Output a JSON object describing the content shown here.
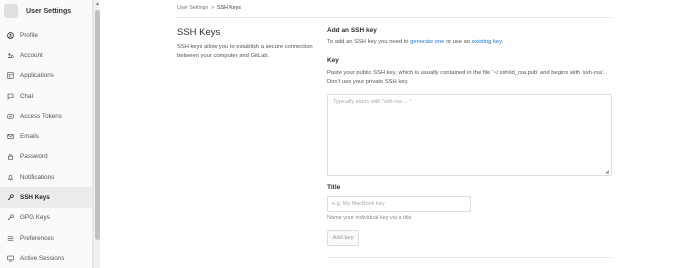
{
  "sidebar": {
    "title": "User Settings",
    "items": [
      {
        "label": "Profile",
        "icon": "profile-icon",
        "active": true
      },
      {
        "label": "Account",
        "icon": "account-icon",
        "active": false
      },
      {
        "label": "Applications",
        "icon": "applications-icon",
        "active": false
      },
      {
        "label": "Chat",
        "icon": "chat-icon",
        "active": false
      },
      {
        "label": "Access Tokens",
        "icon": "token-icon",
        "active": false
      },
      {
        "label": "Emails",
        "icon": "email-icon",
        "active": false
      },
      {
        "label": "Password",
        "icon": "lock-icon",
        "active": false
      },
      {
        "label": "Notifications",
        "icon": "bell-icon",
        "active": false
      },
      {
        "label": "SSH Keys",
        "icon": "key-icon",
        "active": true
      },
      {
        "label": "GPG Keys",
        "icon": "key-icon",
        "active": false
      },
      {
        "label": "Preferences",
        "icon": "preferences-icon",
        "active": false
      },
      {
        "label": "Active Sessions",
        "icon": "sessions-icon",
        "active": false
      }
    ]
  },
  "breadcrumb": {
    "parent": "User Settings",
    "separator": ">",
    "current": "SSH Keys"
  },
  "section": {
    "title": "SSH Keys",
    "description": "SSH keys allow you to establish a secure connection between your computer and GitLab."
  },
  "add_key": {
    "title": "Add an SSH key",
    "intro_prefix": "To add an SSH key you need to ",
    "link_generate": "generate one",
    "intro_middle": " or use an ",
    "link_existing": "existing key",
    "intro_suffix": "."
  },
  "key_field": {
    "label": "Key",
    "help": "Paste your public SSH key, which is usually contained in the file '~/.ssh/id_rsa.pub' and begins with 'ssh-rsa'. Don't use your private SSH key.",
    "placeholder": "Typically starts with \"ssh-rsa …\"",
    "value": ""
  },
  "title_field": {
    "label": "Title",
    "placeholder": "e.g. My MacBook key",
    "help": "Name your individual key via a title",
    "value": ""
  },
  "submit": {
    "label": "Add key"
  },
  "colors": {
    "link": "#1f78d1",
    "active_bg": "#ececec"
  }
}
